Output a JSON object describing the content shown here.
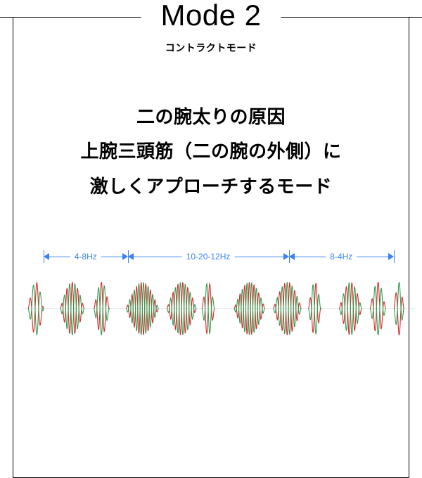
{
  "title": "Mode 2",
  "subtitle": "コントラクトモード",
  "body_lines": [
    "二の腕太りの原因",
    "上腕三頭筋（二の腕の外側）に",
    "激しくアプローチするモード"
  ],
  "freq_segments": [
    {
      "label": "4-8Hz",
      "left_pct": 0,
      "width_pct": 24
    },
    {
      "label": "10-20-12Hz",
      "left_pct": 24,
      "width_pct": 46
    },
    {
      "label": "8-4Hz",
      "left_pct": 70,
      "width_pct": 30
    }
  ],
  "colors": {
    "accent": "#3b82f6",
    "wave_a": "#d92b2b",
    "wave_b": "#2e9e52"
  }
}
